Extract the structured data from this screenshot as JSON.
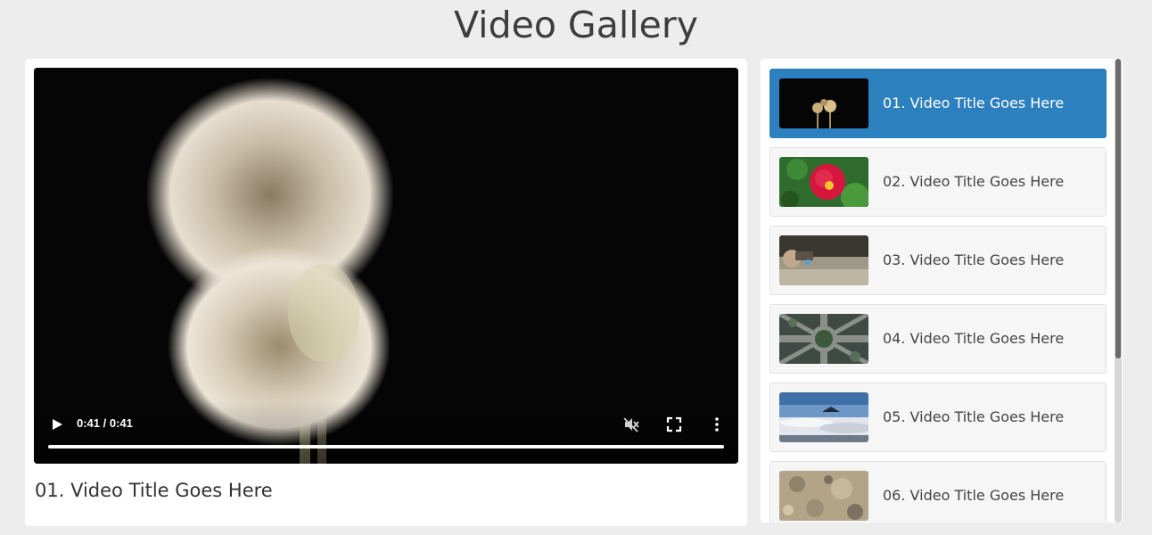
{
  "page": {
    "title": "Video Gallery"
  },
  "player": {
    "time": "0:41 / 0:41",
    "progress_percent": 100,
    "now_playing_title": "01. Video Title Goes Here"
  },
  "playlist": {
    "items": [
      {
        "label": "01. Video Title Goes Here",
        "active": true,
        "thumb": "dandelion-thumb"
      },
      {
        "label": "02. Video Title Goes Here",
        "active": false,
        "thumb": "red-flower-thumb"
      },
      {
        "label": "03. Video Title Goes Here",
        "active": false,
        "thumb": "hands-sand-thumb"
      },
      {
        "label": "04. Video Title Goes Here",
        "active": false,
        "thumb": "roundabout-thumb"
      },
      {
        "label": "05. Video Title Goes Here",
        "active": false,
        "thumb": "mountain-clouds-thumb"
      },
      {
        "label": "06. Video Title Goes Here",
        "active": false,
        "thumb": "rocky-ground-thumb"
      }
    ]
  },
  "colors": {
    "accent": "#2c80bd",
    "background": "#ededed"
  },
  "icons": {
    "play": "play-icon",
    "mute": "mute-icon",
    "fullscreen": "fullscreen-icon",
    "more": "more-vertical-icon"
  }
}
